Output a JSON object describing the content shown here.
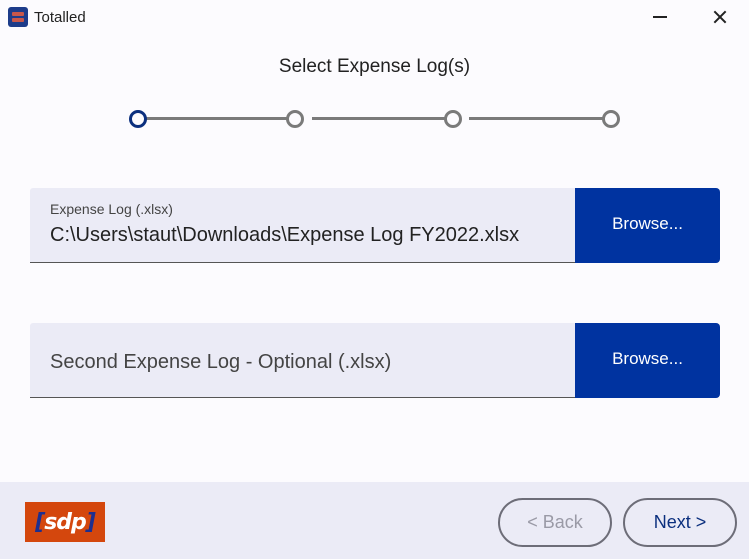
{
  "window": {
    "title": "Totalled",
    "icon": "app-logo-icon",
    "controls": {
      "minimize": "minimize-icon",
      "close": "close-icon"
    }
  },
  "page": {
    "title": "Select Expense Log(s)"
  },
  "stepper": {
    "total_steps": 4,
    "current_step": 1,
    "colors": {
      "active": "#0b2f7e",
      "inactive": "#7a7a7a"
    }
  },
  "fields": [
    {
      "label": "Expense Log (.xlsx)",
      "value": "C:\\Users\\staut\\Downloads\\Expense Log FY2022.xlsx",
      "browse_label": "Browse..."
    },
    {
      "placeholder": "Second Expense Log - Optional (.xlsx)",
      "value": "",
      "browse_label": "Browse..."
    }
  ],
  "footer": {
    "logo_text": "sdp",
    "back_label": "< Back",
    "next_label": "Next >",
    "back_enabled": false
  },
  "colors": {
    "accent": "#0033a0",
    "field_background": "#ebebf6",
    "logo_background": "#d4470d"
  }
}
